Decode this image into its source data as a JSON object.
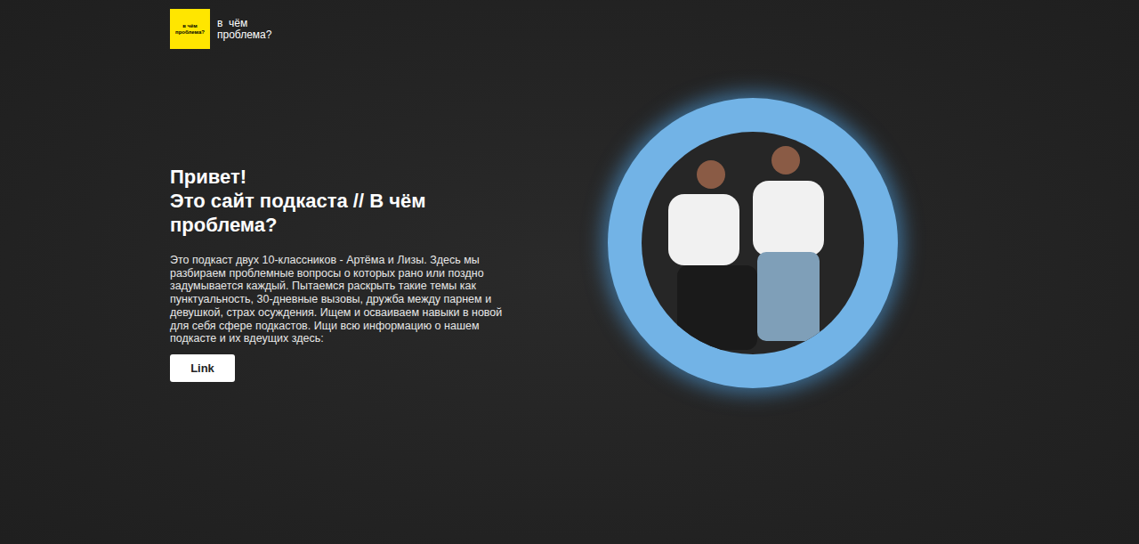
{
  "logo": {
    "badge": "в чём проблема?",
    "name_lines": [
      "в  чём",
      "проблема?"
    ]
  },
  "hero": {
    "greeting": "Привет!",
    "title": "Это сайт подкаста // В чём проблема?",
    "description": "Это подкаст двух 10-классников - Артёма и Лизы. Здесь мы разбираем проблемные вопросы о которых рано или поздно задумывается каждый. Пытаемся раскрыть такие темы как пунктуальность, 30-дневные вызовы, дружба между парнем и девушкой, страх осуждения. Ищем и осваиваем навыки в новой для себя сфере подкастов. Ищи всю информацию о нашем подкасте и их вдеущих здесь:",
    "button": "Link"
  }
}
